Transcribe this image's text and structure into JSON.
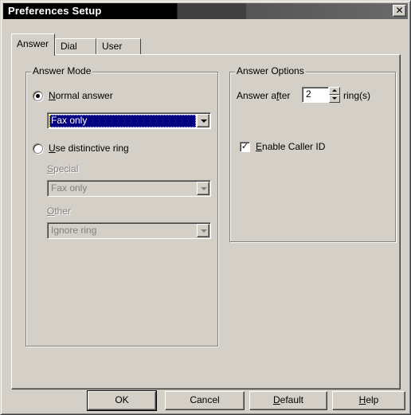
{
  "window": {
    "title": "Preferences Setup",
    "close_label": "✕"
  },
  "tabs": [
    {
      "label": "Answer",
      "active": true
    },
    {
      "label": "Dial",
      "active": false
    },
    {
      "label": "User",
      "active": false
    }
  ],
  "answer_mode": {
    "group_label": "Answer Mode",
    "normal_answer": {
      "mnemonic": "N",
      "label_rest": "ormal answer",
      "selected": true,
      "combo_value": "Fax only"
    },
    "distinctive_ring": {
      "mnemonic": "U",
      "label_rest": "se distinctive ring",
      "selected": false
    },
    "special": {
      "mnemonic": "S",
      "label_rest": "pecial",
      "combo_value": "Fax only"
    },
    "other": {
      "mnemonic": "O",
      "label_rest": "ther",
      "combo_value": "Ignore ring"
    }
  },
  "answer_options": {
    "group_label": "Answer Options",
    "answer_after_prefix": "Answer a",
    "answer_after_mnemonic": "f",
    "answer_after_suffix": "ter",
    "rings_value": "2",
    "rings_unit": "ring(s)",
    "caller_id": {
      "mnemonic": "E",
      "label_rest": "nable Caller ID",
      "checked": true,
      "check_glyph": "✓"
    }
  },
  "buttons": {
    "ok": "OK",
    "cancel": "Cancel",
    "default_mnemonic": "D",
    "default_rest": "efault",
    "help_mnemonic": "H",
    "help_rest": "elp"
  }
}
